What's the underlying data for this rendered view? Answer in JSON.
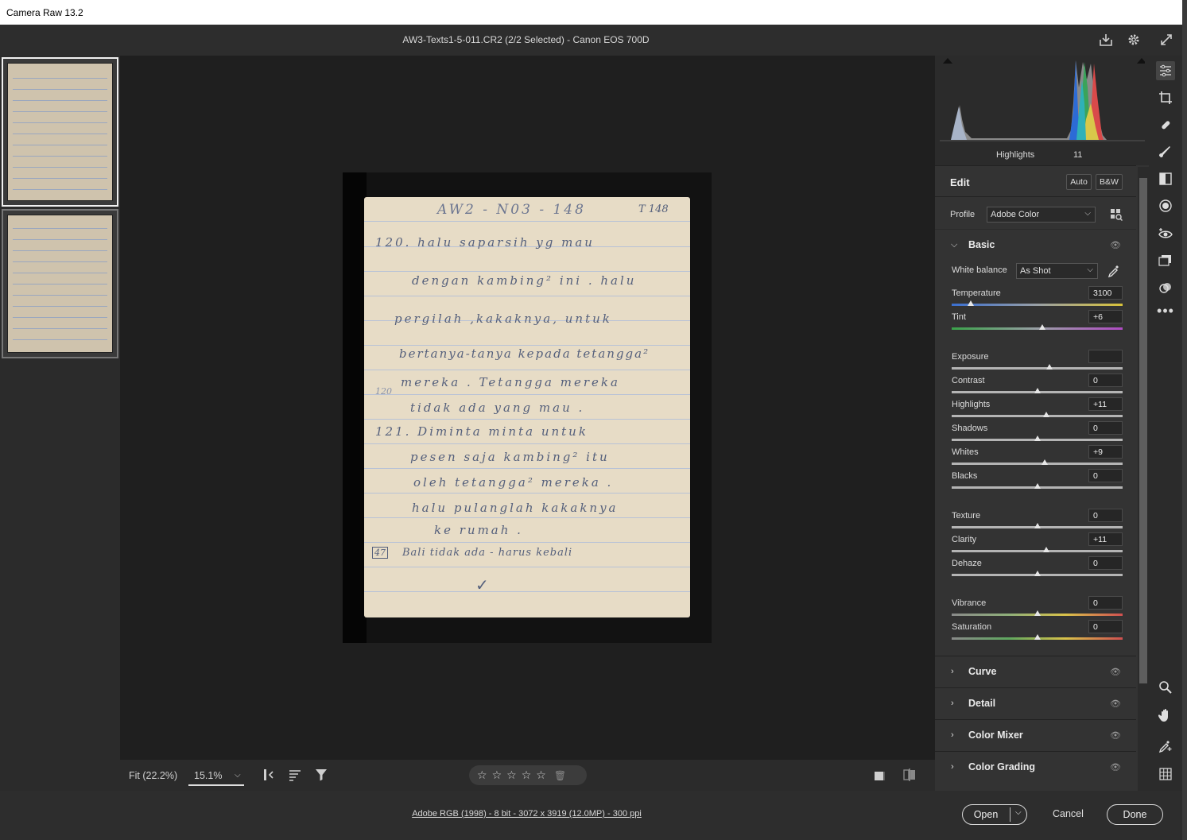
{
  "app": {
    "window_title": "Camera Raw 13.2",
    "document_title": "AW3-Texts1-5-011.CR2  (2/2 Selected)   -   Canon EOS 700D"
  },
  "header_icons": [
    "save-icon",
    "gear-icon",
    "fullscreen-icon"
  ],
  "document": {
    "header_left": "AW2 - N03 - 148",
    "header_right": "T 148",
    "lines": [
      "120.  halu  saparsih  yg  mau",
      "dengan  kambing²  ini  .  halu",
      "pergilah ,kakaknya,  untuk",
      "bertanya-tanya  kepada  tetangga²",
      "mereka  .  Tetangga  mereka",
      "tidak   ada   yang   mau .",
      "121.  Diminta   minta   untuk",
      "pesen  saja  kambing²  itu",
      "oleh  tetangga²  mereka .",
      "halu   pulanglah   kakaknya",
      "ke  rumah .",
      "Bali  tidak ada  - harus  kebali"
    ],
    "margin_note": "120",
    "box_note": "47"
  },
  "bottombar": {
    "fit_label": "Fit (22.2%)",
    "zoom_value": "15.1%",
    "star_count": 5,
    "star_glyph": "☆"
  },
  "footer": {
    "info_link": "Adobe RGB (1998) - 8 bit - 3072 x 3919 (12.0MP) - 300 ppi",
    "open_label": "Open",
    "cancel_label": "Cancel",
    "done_label": "Done"
  },
  "histogram": {
    "highlights_label": "Highlights",
    "highlights_value": "11"
  },
  "edit": {
    "title": "Edit",
    "auto_label": "Auto",
    "bw_label": "B&W",
    "profile_label": "Profile",
    "profile_value": "Adobe Color",
    "basic_title": "Basic",
    "wb_label": "White balance",
    "wb_value": "As Shot"
  },
  "sliders": [
    {
      "label": "Temperature",
      "value": "3100",
      "pos": 0.11,
      "track": "temp"
    },
    {
      "label": "Tint",
      "value": "+6",
      "pos": 0.53,
      "track": "tint"
    },
    {
      "label": "Exposure",
      "value": "",
      "pos": 0.57,
      "track": "gray"
    },
    {
      "label": "Contrast",
      "value": "0",
      "pos": 0.5,
      "track": "gray"
    },
    {
      "label": "Highlights",
      "value": "+11",
      "pos": 0.555,
      "track": "gray"
    },
    {
      "label": "Shadows",
      "value": "0",
      "pos": 0.5,
      "track": "gray"
    },
    {
      "label": "Whites",
      "value": "+9",
      "pos": 0.545,
      "track": "gray"
    },
    {
      "label": "Blacks",
      "value": "0",
      "pos": 0.5,
      "track": "gray"
    },
    {
      "label": "Texture",
      "value": "0",
      "pos": 0.5,
      "track": "gray"
    },
    {
      "label": "Clarity",
      "value": "+11",
      "pos": 0.555,
      "track": "gray"
    },
    {
      "label": "Dehaze",
      "value": "0",
      "pos": 0.5,
      "track": "gray"
    },
    {
      "label": "Vibrance",
      "value": "0",
      "pos": 0.5,
      "track": "vib"
    },
    {
      "label": "Saturation",
      "value": "0",
      "pos": 0.5,
      "track": "sat"
    }
  ],
  "sections": [
    "Curve",
    "Detail",
    "Color Mixer",
    "Color Grading"
  ],
  "colors": {
    "accent_text": "#eaeaea",
    "panel_bg": "#333333"
  }
}
